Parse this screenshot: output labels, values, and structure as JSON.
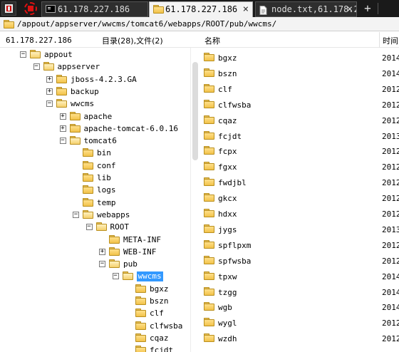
{
  "tabs": [
    {
      "label": "61.178.227.186",
      "active": false,
      "icon": "terminal-icon"
    },
    {
      "label": "61.178.227.186",
      "active": true,
      "icon": "folder-icon"
    },
    {
      "label": "node.txt,61.178.2…",
      "active": false,
      "icon": "document-icon"
    }
  ],
  "toolbar": {
    "add_tab": "+"
  },
  "path": "/appout/appserver/wwcms/tomcat6/webapps/ROOT/pub/wwcms/",
  "header": {
    "host": "61.178.227.186",
    "summary": "目录(28),文件(2)",
    "col_name": "名称",
    "col_time": "时间"
  },
  "tree": [
    {
      "label": "appout",
      "depth": 0,
      "expander": "−",
      "selected": false
    },
    {
      "label": "appserver",
      "depth": 1,
      "expander": "−",
      "selected": false
    },
    {
      "label": "jboss-4.2.3.GA",
      "depth": 2,
      "expander": "+",
      "selected": false
    },
    {
      "label": "backup",
      "depth": 2,
      "expander": "+",
      "selected": false
    },
    {
      "label": "wwcms",
      "depth": 2,
      "expander": "−",
      "selected": false
    },
    {
      "label": "apache",
      "depth": 3,
      "expander": "+",
      "selected": false
    },
    {
      "label": "apache-tomcat-6.0.16",
      "depth": 3,
      "expander": "+",
      "selected": false
    },
    {
      "label": "tomcat6",
      "depth": 3,
      "expander": "−",
      "selected": false
    },
    {
      "label": "bin",
      "depth": 4,
      "expander": "",
      "selected": false
    },
    {
      "label": "conf",
      "depth": 4,
      "expander": "",
      "selected": false
    },
    {
      "label": "lib",
      "depth": 4,
      "expander": "",
      "selected": false
    },
    {
      "label": "logs",
      "depth": 4,
      "expander": "",
      "selected": false
    },
    {
      "label": "temp",
      "depth": 4,
      "expander": "",
      "selected": false
    },
    {
      "label": "webapps",
      "depth": 4,
      "expander": "−",
      "selected": false
    },
    {
      "label": "ROOT",
      "depth": 5,
      "expander": "−",
      "selected": false
    },
    {
      "label": "META-INF",
      "depth": 6,
      "expander": "",
      "selected": false
    },
    {
      "label": "WEB-INF",
      "depth": 6,
      "expander": "+",
      "selected": false
    },
    {
      "label": "pub",
      "depth": 6,
      "expander": "−",
      "selected": false
    },
    {
      "label": "wwcms",
      "depth": 7,
      "expander": "−",
      "selected": true
    },
    {
      "label": "bgxz",
      "depth": 8,
      "expander": "",
      "selected": false
    },
    {
      "label": "bszn",
      "depth": 8,
      "expander": "",
      "selected": false
    },
    {
      "label": "clf",
      "depth": 8,
      "expander": "",
      "selected": false
    },
    {
      "label": "clfwsba",
      "depth": 8,
      "expander": "",
      "selected": false
    },
    {
      "label": "cqaz",
      "depth": 8,
      "expander": "",
      "selected": false
    },
    {
      "label": "fcjdt",
      "depth": 8,
      "expander": "",
      "selected": false
    }
  ],
  "files": [
    {
      "name": "bgxz",
      "time": "2014"
    },
    {
      "name": "bszn",
      "time": "2014"
    },
    {
      "name": "clf",
      "time": "2012"
    },
    {
      "name": "clfwsba",
      "time": "2012"
    },
    {
      "name": "cqaz",
      "time": "2012"
    },
    {
      "name": "fcjdt",
      "time": "2013"
    },
    {
      "name": "fcpx",
      "time": "2012"
    },
    {
      "name": "fgxx",
      "time": "2012"
    },
    {
      "name": "fwdjbl",
      "time": "2012"
    },
    {
      "name": "gkcx",
      "time": "2012"
    },
    {
      "name": "hdxx",
      "time": "2012"
    },
    {
      "name": "jygs",
      "time": "2013"
    },
    {
      "name": "spflpxm",
      "time": "2012"
    },
    {
      "name": "spfwsba",
      "time": "2012"
    },
    {
      "name": "tpxw",
      "time": "2014"
    },
    {
      "name": "tzgg",
      "time": "2014"
    },
    {
      "name": "wgb",
      "time": "2014"
    },
    {
      "name": "wygl",
      "time": "2012"
    },
    {
      "name": "wzdh",
      "time": "2012"
    }
  ],
  "colors": {
    "selection": "#3399ff",
    "tabbar": "#1a1a1a",
    "folder": "#f2c24a"
  }
}
